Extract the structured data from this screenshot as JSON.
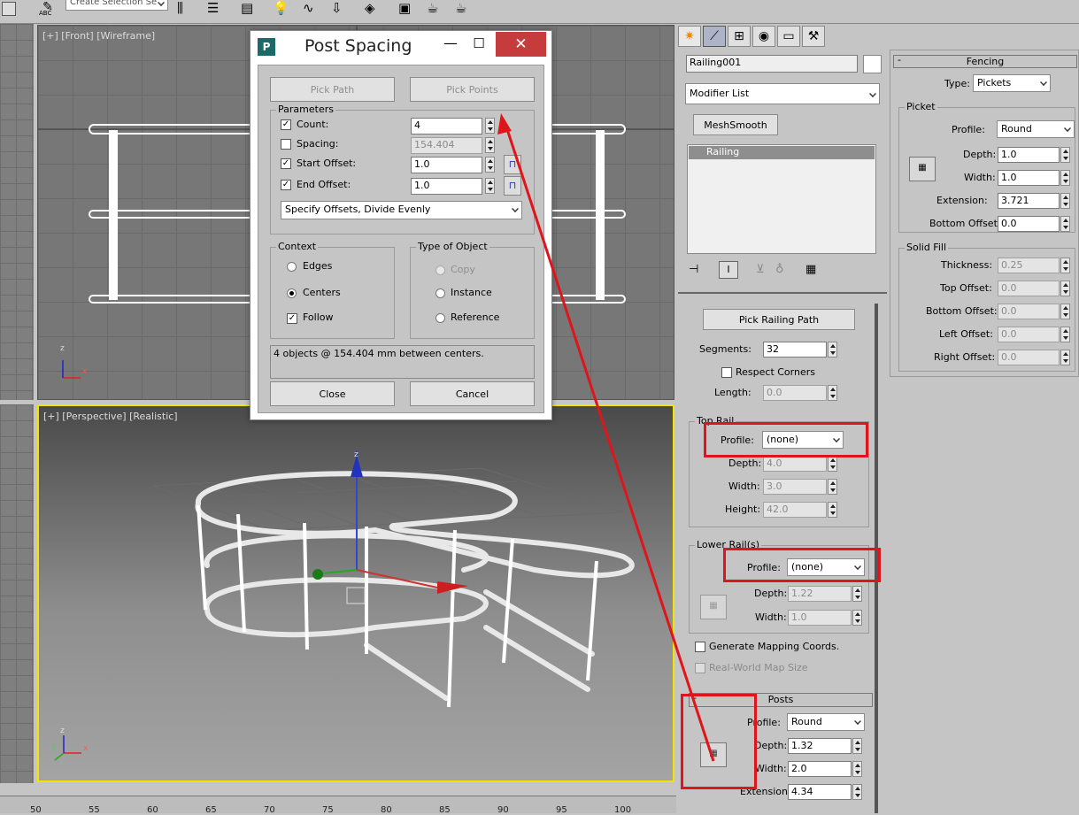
{
  "toolbar": {
    "selection_set_placeholder": "Create Selection Se",
    "abc_label": "ABC"
  },
  "viewports": {
    "front_label": "[+] [Front] [Wireframe]",
    "persp_label": "[+] [Perspective] [Realistic]",
    "axis_x": "x",
    "axis_y": "y",
    "axis_z": "z"
  },
  "timeline": {
    "ticks": [
      "50",
      "55",
      "60",
      "65",
      "70",
      "75",
      "80",
      "85",
      "90",
      "95",
      "100"
    ]
  },
  "dialog": {
    "title": "Post Spacing",
    "pick_path": "Pick Path",
    "pick_points": "Pick Points",
    "parameters": "Parameters",
    "count_label": "Count:",
    "count_value": "4",
    "spacing_label": "Spacing:",
    "spacing_value": "154.404",
    "start_offset_label": "Start Offset:",
    "start_offset_value": "1.0",
    "end_offset_label": "End Offset:",
    "end_offset_value": "1.0",
    "mode_value": "Specify Offsets, Divide Evenly",
    "context": "Context",
    "edges": "Edges",
    "centers": "Centers",
    "follow": "Follow",
    "type_of_object": "Type of Object",
    "copy": "Copy",
    "instance": "Instance",
    "reference": "Reference",
    "status": "4 objects @ 154.404 mm between centers.",
    "close": "Close",
    "cancel": "Cancel"
  },
  "command_panel": {
    "object_name": "Railing001",
    "modifier_list": "Modifier List",
    "meshsmooth": "MeshSmooth",
    "stack_item": "Railing"
  },
  "railing": {
    "pick_path": "Pick Railing Path",
    "segments_label": "Segments:",
    "segments_value": "32",
    "respect_corners": "Respect Corners",
    "length_label": "Length:",
    "length_value": "0.0",
    "top_rail": "Top Rail",
    "profile_label": "Profile:",
    "top_profile": "(none)",
    "depth_label": "Depth:",
    "top_depth": "4.0",
    "width_label": "Width:",
    "top_width": "3.0",
    "height_label": "Height:",
    "top_height": "42.0",
    "lower_rails": "Lower Rail(s)",
    "lower_profile": "(none)",
    "lower_depth": "1.22",
    "lower_width": "1.0",
    "gen_mapping": "Generate Mapping Coords.",
    "real_world": "Real-World Map Size"
  },
  "posts": {
    "title": "Posts",
    "minus": "-",
    "profile_value": "Round",
    "depth_value": "1.32",
    "width_value": "2.0",
    "extension_label": "Extension:",
    "extension_value": "4.34"
  },
  "fencing": {
    "title": "Fencing",
    "minus": "-",
    "type_label": "Type:",
    "type_value": "Pickets",
    "picket": "Picket",
    "profile_label": "Profile:",
    "profile_value": "Round",
    "depth_label": "Depth:",
    "depth_value": "1.0",
    "width_label": "Width:",
    "width_value": "1.0",
    "extension_label": "Extension:",
    "extension_value": "3.721",
    "bottom_offset_label": "Bottom Offset:",
    "bottom_offset_value": "0.0",
    "solid_fill": "Solid Fill",
    "thickness_label": "Thickness:",
    "thickness_value": "0.25",
    "top_offset_label": "Top Offset:",
    "top_offset_value": "0.0",
    "sf_bottom_offset_label": "Bottom Offset:",
    "sf_bottom_offset_value": "0.0",
    "left_offset_label": "Left Offset:",
    "left_offset_value": "0.0",
    "right_offset_label": "Right Offset:",
    "right_offset_value": "0.0"
  },
  "colors": {
    "annotation_red": "#e0151b",
    "active_viewport_border": "#f5e300",
    "panel_bg": "#c5c5c5"
  }
}
